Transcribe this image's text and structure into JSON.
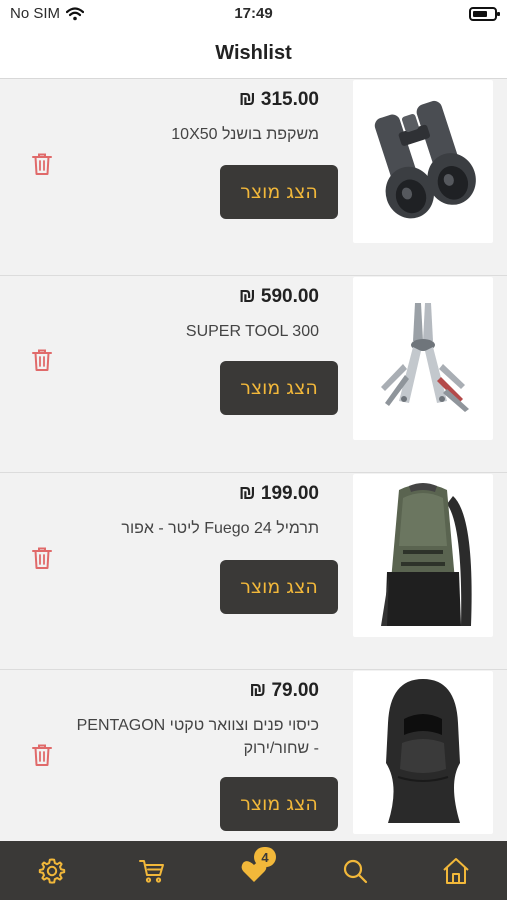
{
  "status_bar": {
    "carrier": "No SIM",
    "time": "17:49",
    "battery_level": 0.7
  },
  "header": {
    "title": "Wishlist"
  },
  "colors": {
    "accent": "#f2b83a",
    "dark": "#3a3937",
    "trash": "#e06a6a"
  },
  "items": [
    {
      "price": "₪ 315.00",
      "name": "משקפת בושנל 10X50",
      "button_label": "הצג מוצר",
      "image_icon": "binoculars-image"
    },
    {
      "price": "₪ 590.00",
      "name": "SUPER TOOL 300",
      "button_label": "הצג מוצר",
      "image_icon": "multitool-image"
    },
    {
      "price": "₪ 199.00",
      "name": "תרמיל Fuego 24 ליטר - אפור",
      "button_label": "הצג מוצר",
      "image_icon": "backpack-image"
    },
    {
      "price": "₪ 79.00",
      "name": "כיסוי פנים וצוואר טקטי PENTAGON - שחור/ירוק",
      "button_label": "הצג מוצר",
      "image_icon": "balaclava-image"
    }
  ],
  "tab_bar": {
    "tabs": [
      {
        "name": "settings",
        "icon": "gear-icon"
      },
      {
        "name": "cart",
        "icon": "cart-icon"
      },
      {
        "name": "wishlist",
        "icon": "heart-icon",
        "badge": "4"
      },
      {
        "name": "search",
        "icon": "search-icon"
      },
      {
        "name": "home",
        "icon": "home-icon"
      }
    ]
  }
}
